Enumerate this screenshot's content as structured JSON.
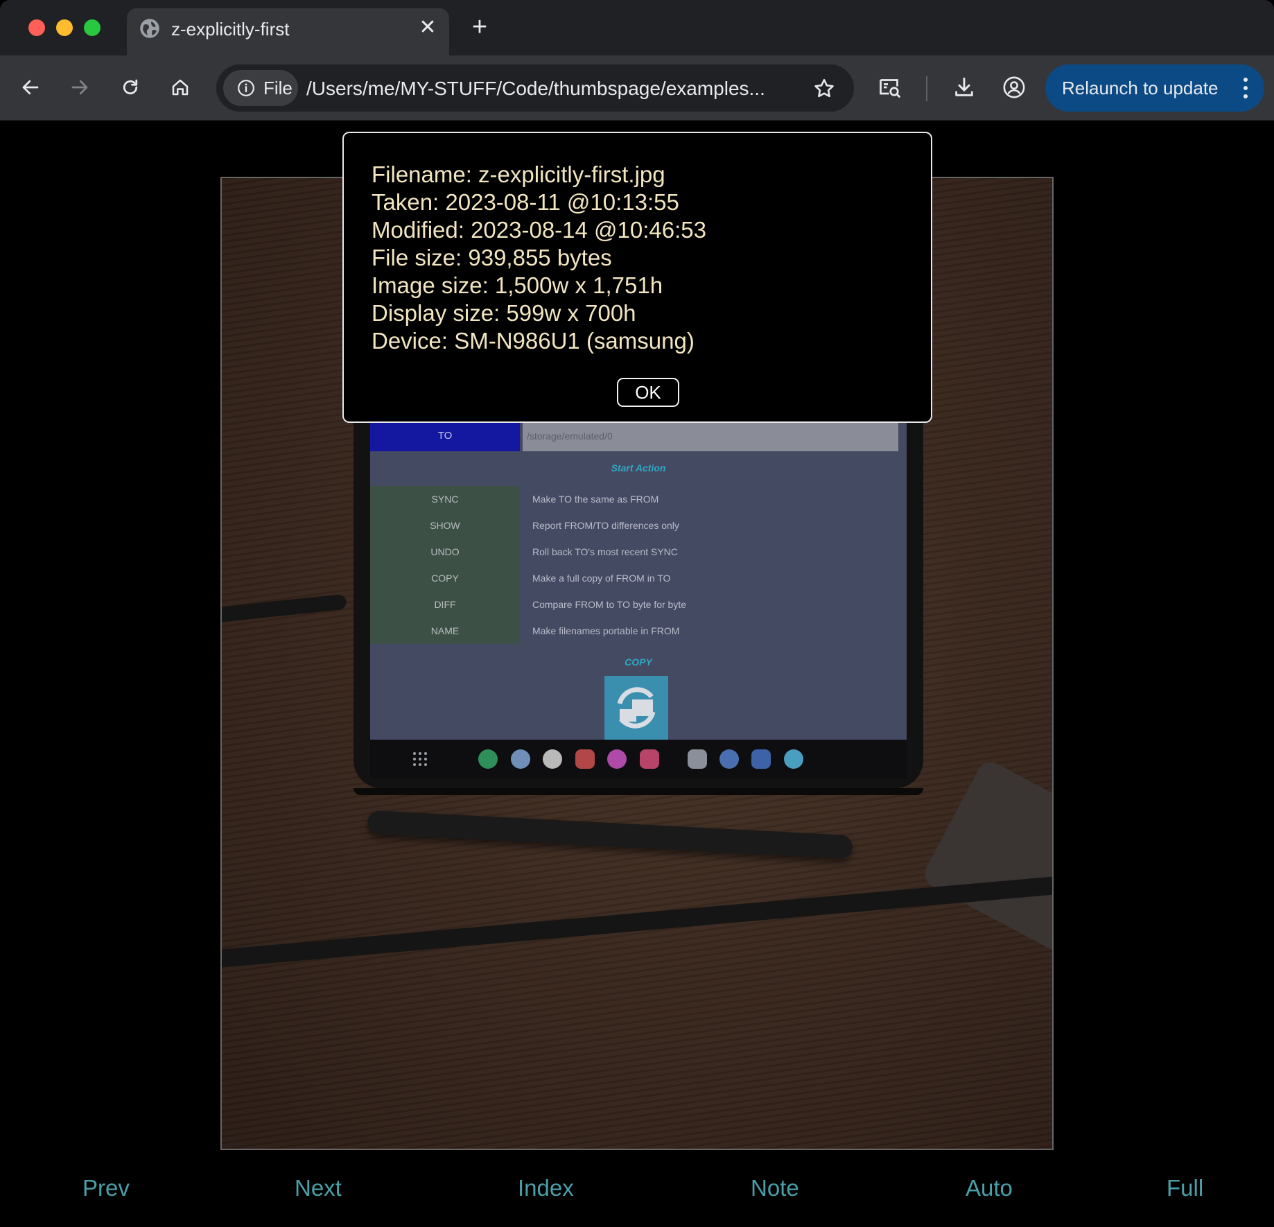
{
  "browser": {
    "tab_title": "z-explicitly-first",
    "tab_close": "✕",
    "new_tab": "+",
    "site_chip": "File",
    "url": "/Users/me/MY-STUFF/Code/thumbspage/examples...",
    "relaunch_label": "Relaunch to update"
  },
  "photo_screen": {
    "to_label": "TO",
    "to_path": "/storage/emulated/0",
    "start_action": "Start Action",
    "actions": [
      {
        "cmd": "SYNC",
        "desc": "Make TO the same as FROM"
      },
      {
        "cmd": "SHOW",
        "desc": "Report FROM/TO differences only"
      },
      {
        "cmd": "UNDO",
        "desc": "Roll back TO's most recent SYNC"
      },
      {
        "cmd": "COPY",
        "desc": "Make a full copy of FROM in TO"
      },
      {
        "cmd": "DIFF",
        "desc": "Compare FROM to TO byte for byte"
      },
      {
        "cmd": "NAME",
        "desc": "Make filenames portable in FROM"
      }
    ],
    "copy_label": "COPY"
  },
  "dialog": {
    "lines": [
      "Filename: z-explicitly-first.jpg",
      "Taken: 2023-08-11 @10:13:55",
      "Modified: 2023-08-14 @10:46:53",
      "File size: 939,855 bytes",
      "Image size: 1,500w x 1,751h",
      "Display size: 599w x 700h",
      "Device: SM-N986U1 (samsung)"
    ],
    "ok_label": "OK"
  },
  "nav": {
    "prev": "Prev",
    "next": "Next",
    "index": "Index",
    "note": "Note",
    "auto": "Auto",
    "full": "Full"
  },
  "colors": {
    "nav_link": "#4a9fa8",
    "dialog_text": "#f2e5c0",
    "relaunch_bg": "#0c4a86"
  }
}
